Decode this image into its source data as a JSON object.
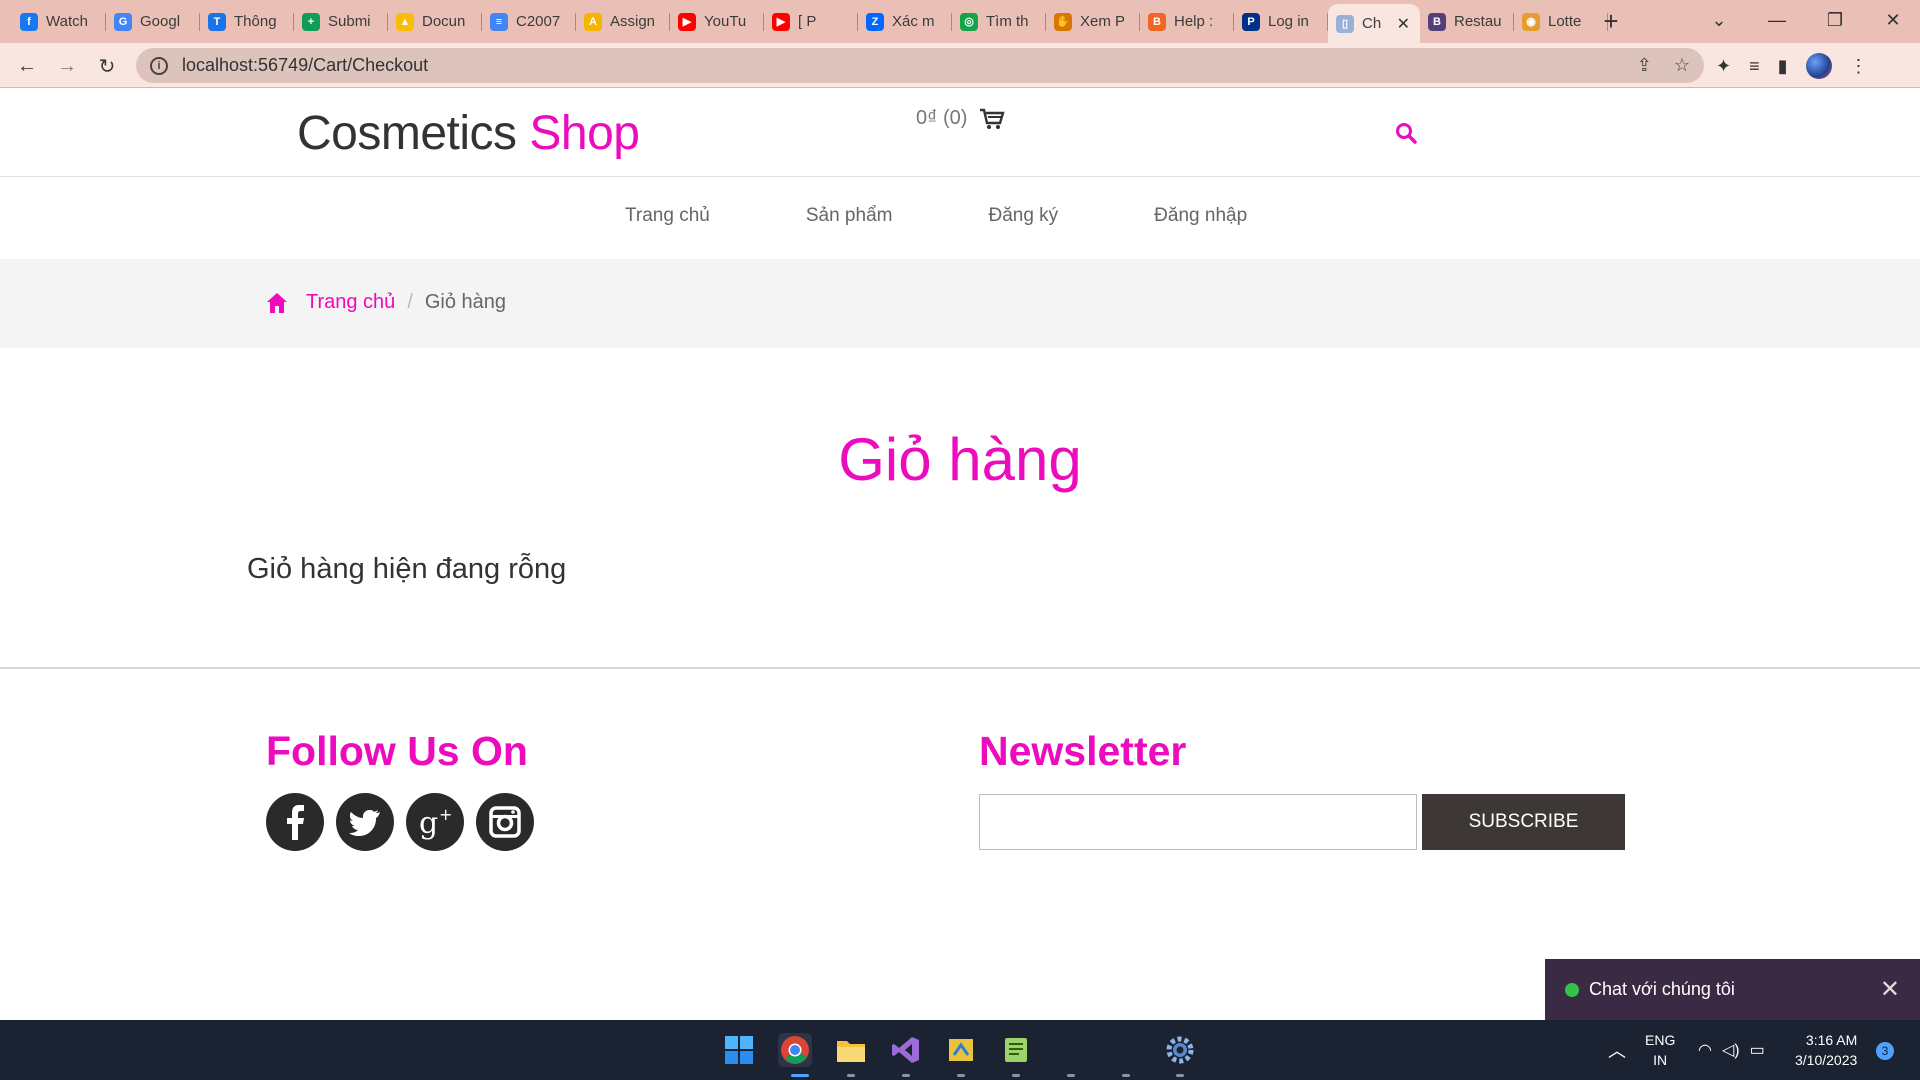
{
  "browser": {
    "tabs": [
      {
        "label": "Watch",
        "color": "#1877f2",
        "glyph": "f"
      },
      {
        "label": "Googl",
        "color": "#4285f4",
        "glyph": "G"
      },
      {
        "label": "Thông",
        "color": "#1a73e8",
        "glyph": "T"
      },
      {
        "label": "Submi",
        "color": "#0f9d58",
        "glyph": "+"
      },
      {
        "label": "Docun",
        "color": "#fbbc04",
        "glyph": "▲"
      },
      {
        "label": "C2007",
        "color": "#4285f4",
        "glyph": "≡"
      },
      {
        "label": "Assign",
        "color": "#f4b400",
        "glyph": "A"
      },
      {
        "label": "YouTu",
        "color": "#ff0000",
        "glyph": "▶"
      },
      {
        "label": "[ P",
        "color": "#ff0000",
        "glyph": "▶"
      },
      {
        "label": "Xác m",
        "color": "#0068ff",
        "glyph": "Z"
      },
      {
        "label": "Tìm th",
        "color": "#16a34a",
        "glyph": "◎"
      },
      {
        "label": "Xem P",
        "color": "#d97706",
        "glyph": "✋"
      },
      {
        "label": "Help :",
        "color": "#f26522",
        "glyph": "B"
      },
      {
        "label": "Log in",
        "color": "#003087",
        "glyph": "P"
      },
      {
        "label": "Ch",
        "color": "#9ab0d6",
        "glyph": "▯",
        "active": true
      },
      {
        "label": "Restau",
        "color": "#563d7c",
        "glyph": "B"
      },
      {
        "label": "Lotte",
        "color": "#e89b2f",
        "glyph": "◉"
      }
    ],
    "url": "localhost:56749/Cart/Checkout"
  },
  "header": {
    "logo_main": "Cosmetics",
    "logo_accent": "Shop",
    "cart_summary": "0₫ (0)"
  },
  "nav": {
    "items": [
      "Trang chủ",
      "Sản phẩm",
      "Đăng ký",
      "Đăng nhập"
    ]
  },
  "breadcrumb": {
    "home": "Trang chủ",
    "current": "Giỏ hàng"
  },
  "content": {
    "title": "Giỏ hàng",
    "empty_message": "Giỏ hàng hiện đang rỗng"
  },
  "footer": {
    "follow_title": "Follow Us On",
    "social": [
      "facebook-icon",
      "twitter-icon",
      "google-plus-icon",
      "instagram-icon"
    ],
    "newsletter_title": "Newsletter",
    "subscribe_label": "SUBSCRIBE"
  },
  "chat": {
    "label": "Chat với chúng tôi"
  },
  "taskbar": {
    "lang_top": "ENG",
    "lang_bottom": "IN",
    "time": "3:16 AM",
    "date": "3/10/2023",
    "notifications": "3"
  },
  "colors": {
    "accent": "#ec0bbd",
    "chrome_tabstrip": "#eac0b6",
    "button_dark": "#3d3836",
    "chat_bg": "#3b2a44"
  }
}
